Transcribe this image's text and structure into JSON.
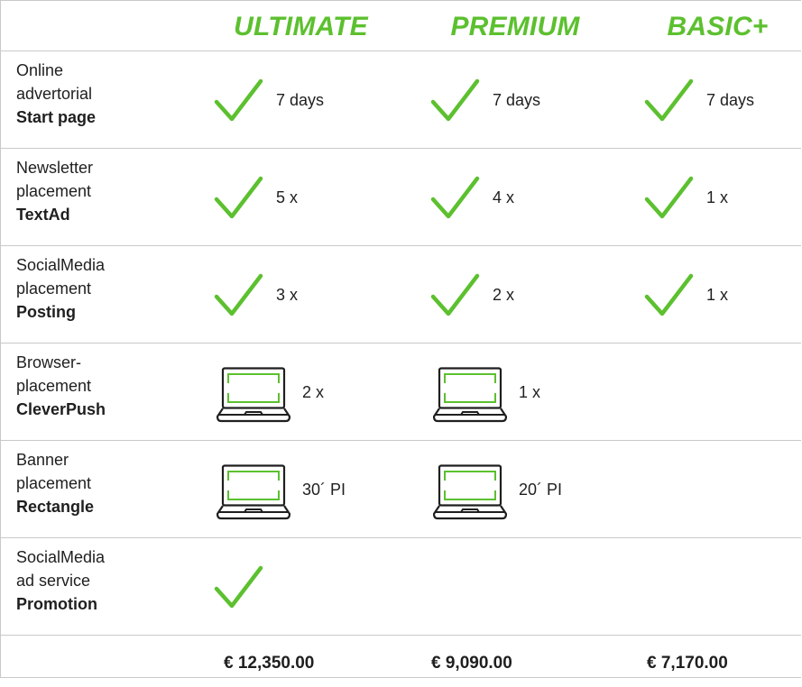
{
  "header": {
    "tiers": [
      "ULTIMATE",
      "PREMIUM",
      "BASIC+"
    ]
  },
  "colors": {
    "accent": "#5cc02f",
    "text": "#1f1f1f",
    "border": "#c9c9c9"
  },
  "rows": [
    {
      "label_lines": [
        "Online",
        "advertorial"
      ],
      "name": "Start page",
      "cells": [
        {
          "icon": "check-icon",
          "value": "7 days"
        },
        {
          "icon": "check-icon",
          "value": "7 days"
        },
        {
          "icon": "check-icon",
          "value": "7 days"
        }
      ]
    },
    {
      "label_lines": [
        "Newsletter",
        "placement"
      ],
      "name": "TextAd",
      "cells": [
        {
          "icon": "check-icon",
          "value": "5 x"
        },
        {
          "icon": "check-icon",
          "value": "4 x"
        },
        {
          "icon": "check-icon",
          "value": "1 x"
        }
      ]
    },
    {
      "label_lines": [
        "SocialMedia",
        "placement"
      ],
      "name": "Posting",
      "cells": [
        {
          "icon": "check-icon",
          "value": "3 x"
        },
        {
          "icon": "check-icon",
          "value": "2 x"
        },
        {
          "icon": "check-icon",
          "value": "1 x"
        }
      ]
    },
    {
      "label_lines": [
        "Browser-",
        "placement"
      ],
      "name": "CleverPush",
      "cells": [
        {
          "icon": "laptop-icon",
          "value": "2 x"
        },
        {
          "icon": "laptop-icon",
          "value": "1 x"
        },
        null
      ]
    },
    {
      "label_lines": [
        "Banner",
        "placement"
      ],
      "name": "Rectangle",
      "cells": [
        {
          "icon": "laptop-icon",
          "value": "30´ PI"
        },
        {
          "icon": "laptop-icon",
          "value": "20´ PI"
        },
        null
      ]
    },
    {
      "label_lines": [
        "SocialMedia",
        "ad service"
      ],
      "name": "Promotion",
      "cells": [
        {
          "icon": "check-icon",
          "value": ""
        },
        null,
        null
      ]
    }
  ],
  "prices": [
    "€ 12,350.00",
    "€ 9,090.00",
    "€ 7,170.00"
  ]
}
